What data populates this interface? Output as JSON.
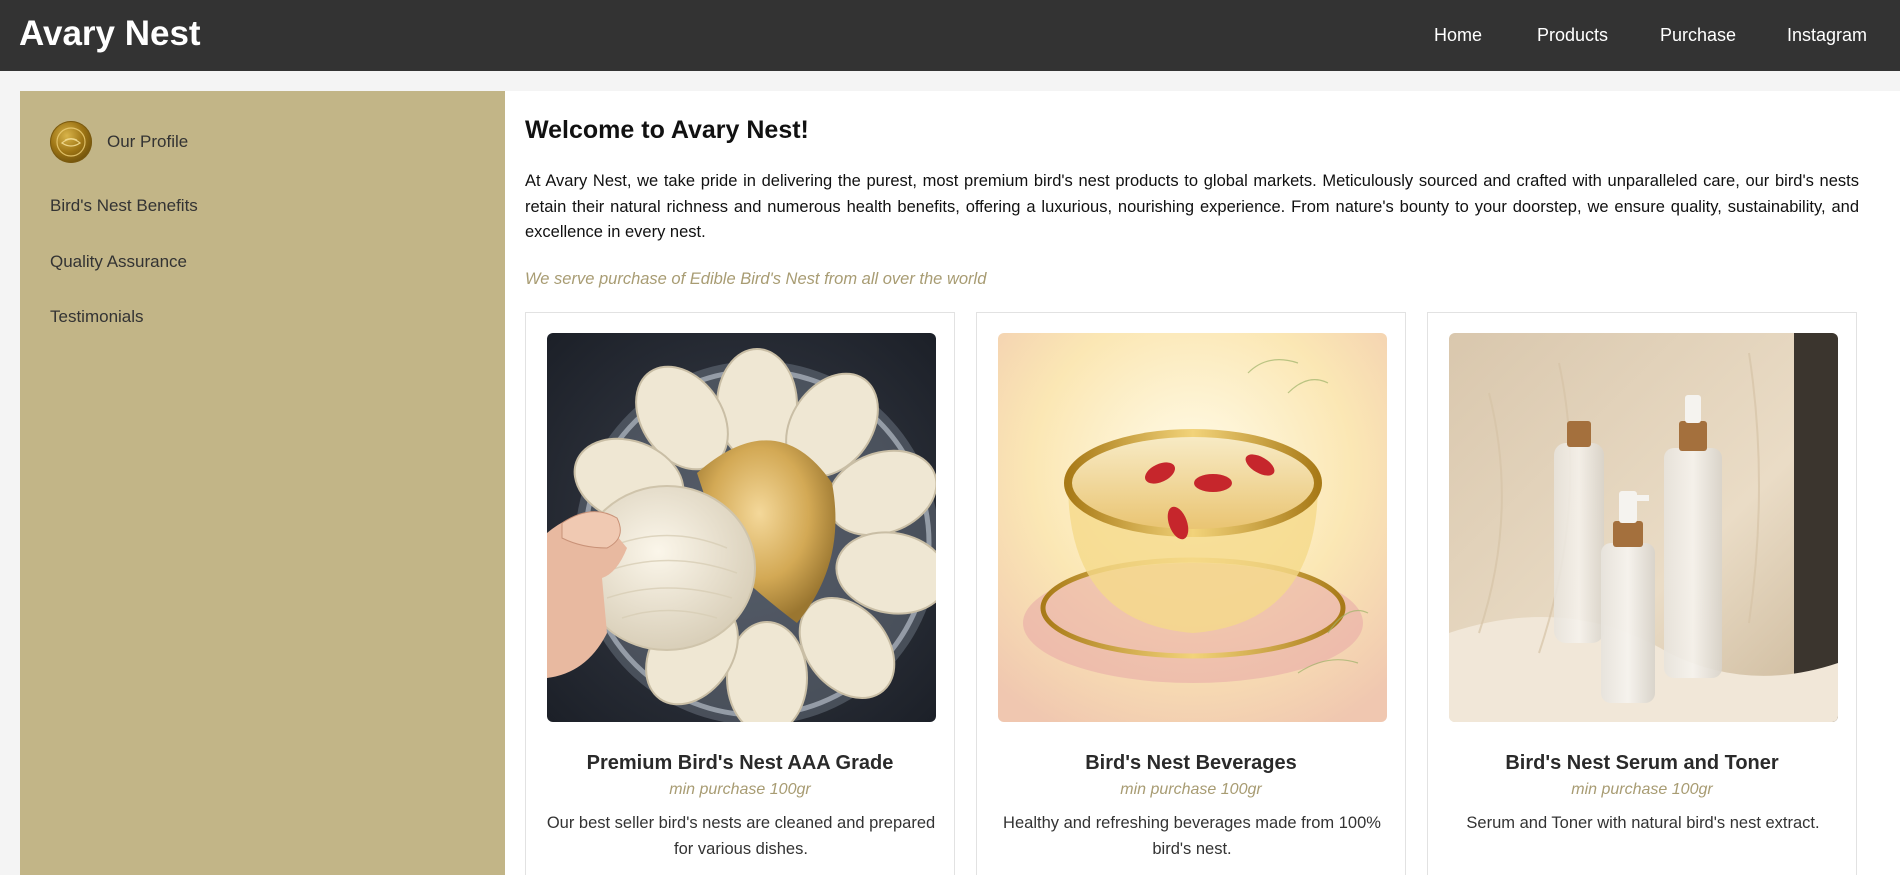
{
  "header": {
    "brand": "Avary Nest",
    "nav": [
      {
        "label": "Home"
      },
      {
        "label": "Products"
      },
      {
        "label": "Purchase"
      },
      {
        "label": "Instagram"
      }
    ]
  },
  "sidebar": {
    "avatar_icon": "company-logo-icon",
    "items": [
      {
        "label": "Our Profile"
      },
      {
        "label": "Bird's Nest Benefits"
      },
      {
        "label": "Quality Assurance"
      },
      {
        "label": "Testimonials"
      }
    ]
  },
  "main": {
    "title": "Welcome to Avary Nest!",
    "intro": "At Avary Nest, we take pride in delivering the purest, most premium bird's nest products to global markets. Meticulously sourced and crafted with unparalleled care, our bird's nests retain their natural richness and numerous health benefits, offering a luxurious, nourishing experience. From nature's bounty to your doorstep, we ensure quality, sustainability, and excellence in every nest.",
    "tagline": "We serve purchase of Edible Bird's Nest from all over the world",
    "products": [
      {
        "name": "Premium Bird's Nest AAA Grade",
        "min_purchase": "min purchase 100gr",
        "description": "Our best seller bird's nests are cleaned and prepared for various dishes."
      },
      {
        "name": "Bird's Nest Beverages",
        "min_purchase": "min purchase 100gr",
        "description": "Healthy and refreshing beverages made from 100% bird's nest."
      },
      {
        "name": "Bird's Nest Serum and Toner",
        "min_purchase": "min purchase 100gr",
        "description": "Serum and Toner with natural bird's nest extract."
      }
    ]
  },
  "colors": {
    "header_bg": "#333333",
    "sidebar_bg": "#c2b587",
    "accent_text": "#a89c73"
  }
}
